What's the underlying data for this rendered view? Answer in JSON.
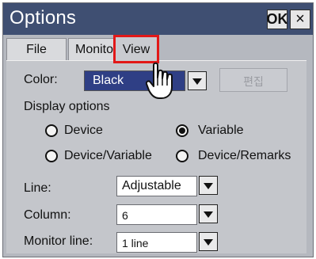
{
  "window": {
    "title": "Options",
    "ok_label": "OK",
    "close_label": "×"
  },
  "tabs": [
    {
      "label": "File"
    },
    {
      "label": "Monitor"
    },
    {
      "label": "View",
      "active": true,
      "highlight_color": "#e21818"
    }
  ],
  "view": {
    "color_label": "Color:",
    "color_value": "Black",
    "edit_button_label": "편집",
    "display_options_label": "Display options",
    "display_options": [
      {
        "label": "Device",
        "selected": false
      },
      {
        "label": "Variable",
        "selected": true
      },
      {
        "label": "Device/Variable",
        "selected": false
      },
      {
        "label": "Device/Remarks",
        "selected": false
      }
    ],
    "line_label": "Line:",
    "line_value": "Adjustable",
    "column_label": "Column:",
    "column_value": "6",
    "monitor_line_label": "Monitor line:",
    "monitor_line_value": "1 line"
  },
  "colors": {
    "titlebar": "#3f4f72",
    "selected_item": "#2f3f85",
    "panel": "#c4c6cb"
  }
}
